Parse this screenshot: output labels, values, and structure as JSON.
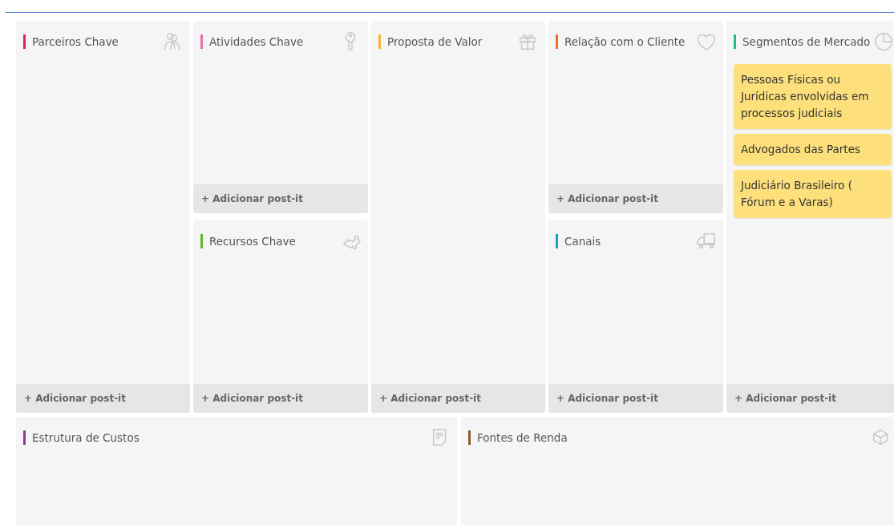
{
  "columns": [
    {
      "sections": [
        {
          "title": "Parceiros Chave",
          "color": "#d6264f",
          "add_button": "+ Adicionar post-it"
        }
      ]
    },
    {
      "sections": [
        {
          "title": "Atividades Chave",
          "color": "#e86fae",
          "add_button": "+ Adicionar post-it"
        },
        {
          "title": "Recursos Chave",
          "color": "#5cb82a",
          "add_button": "+ Adicionar post-it"
        }
      ]
    },
    {
      "sections": [
        {
          "title": "Proposta de Valor",
          "color": "#f8b23a",
          "add_button": "+ Adicionar post-it"
        }
      ]
    },
    {
      "sections": [
        {
          "title": "Relação com o Cliente",
          "color": "#f26b2f",
          "add_button": "+ Adicionar post-it"
        },
        {
          "title": "Canais",
          "color": "#1aa3c9",
          "add_button": "+ Adicionar post-it"
        }
      ]
    },
    {
      "sections": [
        {
          "title": "Segmentos de Mercado",
          "color": "#1fbf80",
          "notes": [
            {
              "text": "Pessoas Físicas ou Jurídicas envolvidas em processos judiciais"
            },
            {
              "text": "Advogados das Partes"
            },
            {
              "text": "Judiciário Brasileiro ( Fórum e a Varas)"
            }
          ],
          "add_button": "+ Adicionar post-it"
        }
      ]
    }
  ],
  "bottom": [
    {
      "title": "Estrutura de Custos",
      "color": "#8e3a96"
    },
    {
      "title": "Fontes de Renda",
      "color": "#8a5a2e"
    }
  ]
}
